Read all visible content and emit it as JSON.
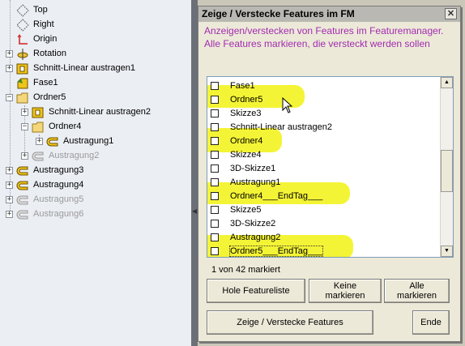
{
  "tree": {
    "items": [
      {
        "label": "Top",
        "icon": "plane-icon",
        "grey": false
      },
      {
        "label": "Right",
        "icon": "plane-icon",
        "grey": false
      },
      {
        "label": "Origin",
        "icon": "origin-icon",
        "grey": false
      },
      {
        "label": "Rotation",
        "icon": "revolve-icon",
        "grey": false
      },
      {
        "label": "Schnitt-Linear austragen1",
        "icon": "cut-extrude-icon",
        "grey": false
      },
      {
        "label": "Fase1",
        "icon": "chamfer-icon",
        "grey": false
      },
      {
        "label": "Ordner5",
        "icon": "folder-icon",
        "grey": false
      },
      {
        "label": "Schnitt-Linear austragen2",
        "icon": "cut-extrude-icon",
        "grey": false
      },
      {
        "label": "Ordner4",
        "icon": "folder-icon",
        "grey": false
      },
      {
        "label": "Austragung1",
        "icon": "extrude-icon",
        "grey": false
      },
      {
        "label": "Austragung2",
        "icon": "extrude-icon",
        "grey": true
      },
      {
        "label": "Austragung3",
        "icon": "extrude-icon",
        "grey": false
      },
      {
        "label": "Austragung4",
        "icon": "extrude-icon",
        "grey": false
      },
      {
        "label": "Austragung5",
        "icon": "extrude-icon",
        "grey": true
      },
      {
        "label": "Austragung6",
        "icon": "extrude-icon",
        "grey": true
      }
    ]
  },
  "dialog": {
    "title": "Zeige / Verstecke Features im FM",
    "close": "✕",
    "instructions": "Anzeigen/verstecken von Features im Featuremanager. Alle Features markieren, die versteckt werden sollen",
    "list": [
      "Fase1",
      "Ordner5",
      "Skizze3",
      "Schnitt-Linear austragen2",
      "Ordner4",
      "Skizze4",
      "3D-Skizze1",
      "Austragung1",
      "Ordner4___EndTag___",
      "Skizze5",
      "3D-Skizze2",
      "Austragung2",
      "Ordner5___EndTag___"
    ],
    "status": "1 von 42 markiert",
    "buttons": {
      "get_list": "Hole Featureliste",
      "mark_none": "Keine markieren",
      "mark_all": "Alle markieren",
      "toggle": "Zeige / Verstecke Features",
      "end": "Ende"
    },
    "scroll_up": "▲",
    "scroll_down": "▼"
  },
  "colors": {
    "instruction_text": "#a22bb0",
    "highlight": "#f2f20a",
    "tree_background": "#ebeef3",
    "dialog_background": "#ece9d8"
  }
}
